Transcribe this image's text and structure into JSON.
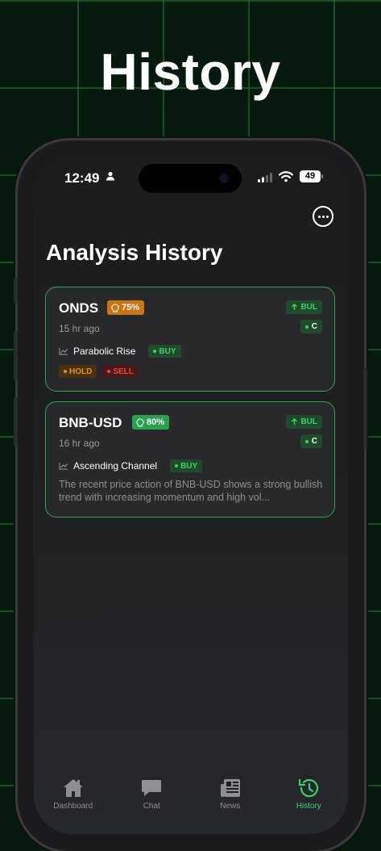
{
  "promo": {
    "title": "History"
  },
  "status_bar": {
    "time": "12:49",
    "battery": "49"
  },
  "header": {
    "title": "Analysis History"
  },
  "cards": [
    {
      "symbol": "ONDS",
      "confidence": "75%",
      "confidence_color": "#c97514",
      "time_ago": "15 hr ago",
      "trend": "BUL",
      "grade": "C",
      "pattern": "Parabolic Rise",
      "signals": [
        "BUY",
        "HOLD",
        "SELL"
      ]
    },
    {
      "symbol": "BNB-USD",
      "confidence": "80%",
      "confidence_color": "#2aa14e",
      "time_ago": "16 hr ago",
      "trend": "BUL",
      "grade": "C",
      "pattern": "Ascending Channel",
      "signals": [
        "BUY"
      ],
      "summary": "The recent price action of BNB-USD shows a strong bullish trend with increasing momentum and high vol..."
    }
  ],
  "tabbar": {
    "items": [
      {
        "label": "Dashboard",
        "icon": "home-icon"
      },
      {
        "label": "Chat",
        "icon": "chat-icon"
      },
      {
        "label": "News",
        "icon": "news-icon"
      },
      {
        "label": "History",
        "icon": "history-icon",
        "active": true
      }
    ]
  },
  "colors": {
    "accent": "#3fd06a",
    "card_border": "#2fa554",
    "background": "#051a0d"
  }
}
